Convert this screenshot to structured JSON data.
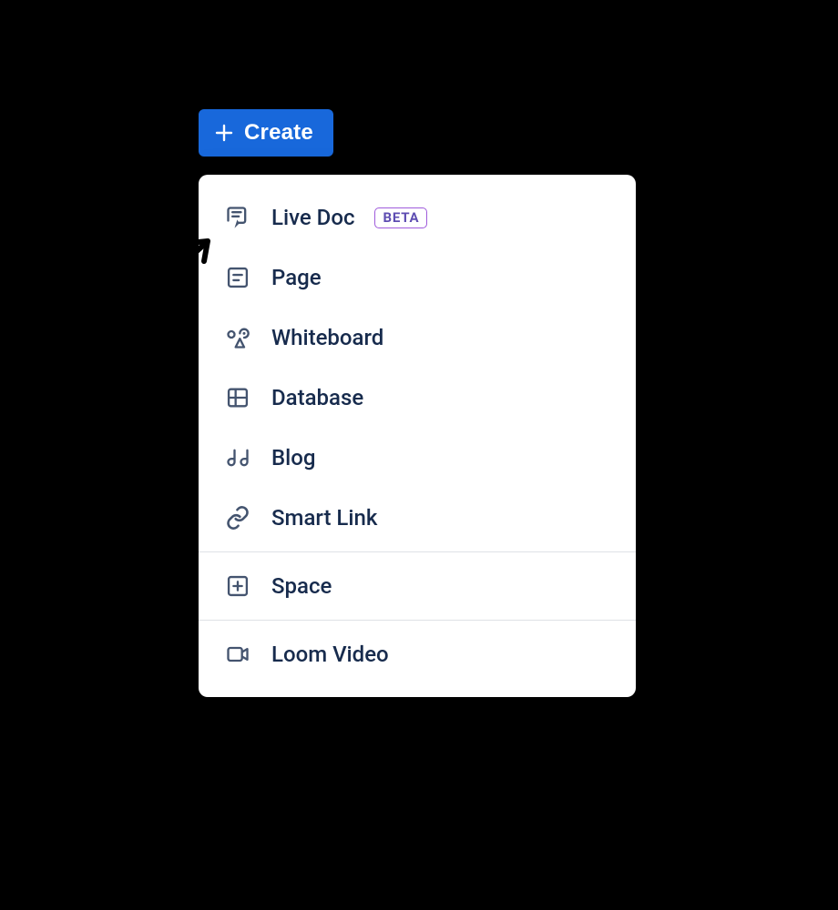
{
  "create_button": {
    "label": "Create"
  },
  "menu": {
    "items": [
      {
        "name": "live-doc",
        "label": "Live Doc",
        "badge": "BETA"
      },
      {
        "name": "page",
        "label": "Page"
      },
      {
        "name": "whiteboard",
        "label": "Whiteboard"
      },
      {
        "name": "database",
        "label": "Database"
      },
      {
        "name": "blog",
        "label": "Blog"
      },
      {
        "name": "smart-link",
        "label": "Smart Link"
      }
    ],
    "section2": [
      {
        "name": "space",
        "label": "Space"
      }
    ],
    "section3": [
      {
        "name": "loom-video",
        "label": "Loom Video"
      }
    ]
  }
}
